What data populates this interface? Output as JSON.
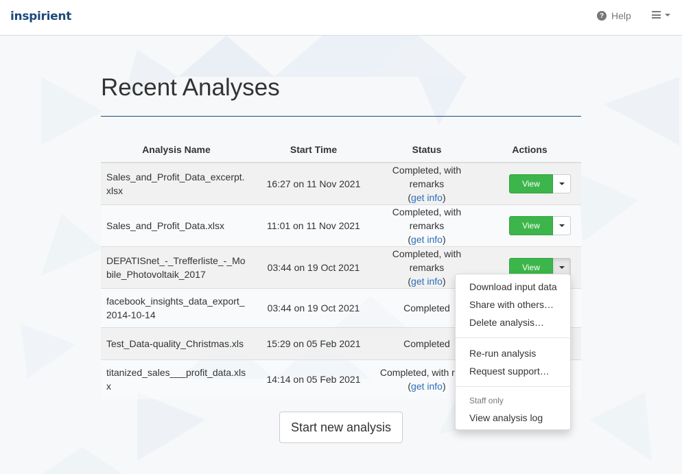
{
  "brand": {
    "name": "inspirient"
  },
  "nav": {
    "help_label": "Help"
  },
  "page": {
    "title": "Recent Analyses",
    "start_button": "Start new analysis"
  },
  "table": {
    "headers": {
      "name": "Analysis Name",
      "start_time": "Start Time",
      "status": "Status",
      "actions": "Actions"
    },
    "rows": [
      {
        "name": "Sales_and_Profit_Data_excerpt.xlsx",
        "start_time": "16:27 on 11 Nov 2021",
        "status": "Completed, with remarks",
        "info_link": "get info",
        "view_label": "View"
      },
      {
        "name": "Sales_and_Profit_Data.xlsx",
        "start_time": "11:01 on 11 Nov 2021",
        "status": "Completed, with remarks",
        "info_link": "get info",
        "view_label": "View"
      },
      {
        "name": "DEPATISnet_-_Trefferliste_-_Mobile_Photovoltaik_2017",
        "start_time": "03:44 on 19 Oct 2021",
        "status": "Completed, with remarks",
        "info_link": "get info",
        "view_label": "View"
      },
      {
        "name": "facebook_insights_data_export_2014-10-14",
        "start_time": "03:44 on 19 Oct 2021",
        "status": "Completed"
      },
      {
        "name": "Test_Data-quality_Christmas.xls",
        "start_time": "15:29 on 05 Feb 2021",
        "status": "Completed"
      },
      {
        "name": "titanized_sales___profit_data.xlsx",
        "start_time": "14:14 on 05 Feb 2021",
        "status": "Completed, with rema",
        "info_link": "get info"
      }
    ]
  },
  "dropdown": {
    "items_group1": [
      "Download input data",
      "Share with others…",
      "Delete analysis…"
    ],
    "items_group2": [
      "Re-run analysis",
      "Request support…"
    ],
    "staff_header": "Staff only",
    "items_group3": [
      "View analysis log"
    ]
  },
  "colors": {
    "brand": "#1d4a7a",
    "view_button": "#3cb54a",
    "link": "#2a6fb8"
  },
  "icons": {
    "help": "question-circle-icon",
    "menu": "hamburger-menu-icon"
  }
}
